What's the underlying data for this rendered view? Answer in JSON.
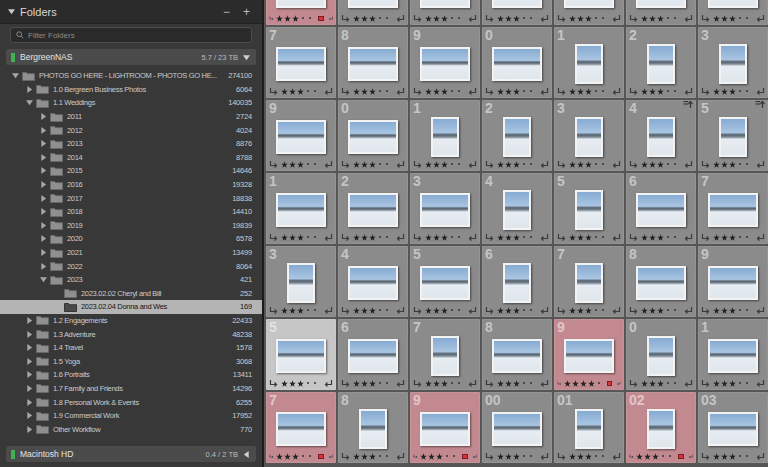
{
  "panel": {
    "title": "Folders",
    "expanded": true,
    "buttons": [
      "−",
      "+"
    ]
  },
  "filter": {
    "placeholder": "Filter Folders"
  },
  "volumes": [
    {
      "name": "BergreenNAS",
      "usage": "5.7 / 23 TB",
      "expanded": true
    },
    {
      "name": "Macintosh HD",
      "usage": "0.4 / 2 TB",
      "expanded": false
    }
  ],
  "folders": [
    {
      "name": "PHOTOS GO HERE - LIGHTROOM - PHOTOS GO HE...",
      "count": "274100",
      "depth": 0,
      "has_children": true,
      "expanded": true,
      "selected": false
    },
    {
      "name": "1.0 Bergreen Business Photos",
      "count": "6064",
      "depth": 1,
      "has_children": true,
      "expanded": false,
      "selected": false
    },
    {
      "name": "1.1 Weddings",
      "count": "140035",
      "depth": 1,
      "has_children": true,
      "expanded": true,
      "selected": false
    },
    {
      "name": "2011",
      "count": "2724",
      "depth": 2,
      "has_children": true,
      "expanded": false,
      "selected": false
    },
    {
      "name": "2012",
      "count": "4024",
      "depth": 2,
      "has_children": true,
      "expanded": false,
      "selected": false
    },
    {
      "name": "2013",
      "count": "8876",
      "depth": 2,
      "has_children": true,
      "expanded": false,
      "selected": false
    },
    {
      "name": "2014",
      "count": "8788",
      "depth": 2,
      "has_children": true,
      "expanded": false,
      "selected": false
    },
    {
      "name": "2015",
      "count": "14646",
      "depth": 2,
      "has_children": true,
      "expanded": false,
      "selected": false
    },
    {
      "name": "2016",
      "count": "19328",
      "depth": 2,
      "has_children": true,
      "expanded": false,
      "selected": false
    },
    {
      "name": "2017",
      "count": "18838",
      "depth": 2,
      "has_children": true,
      "expanded": false,
      "selected": false
    },
    {
      "name": "2018",
      "count": "14410",
      "depth": 2,
      "has_children": true,
      "expanded": false,
      "selected": false
    },
    {
      "name": "2019",
      "count": "19839",
      "depth": 2,
      "has_children": true,
      "expanded": false,
      "selected": false
    },
    {
      "name": "2020",
      "count": "6578",
      "depth": 2,
      "has_children": true,
      "expanded": false,
      "selected": false
    },
    {
      "name": "2021",
      "count": "13499",
      "depth": 2,
      "has_children": true,
      "expanded": false,
      "selected": false
    },
    {
      "name": "2022",
      "count": "8064",
      "depth": 2,
      "has_children": true,
      "expanded": false,
      "selected": false
    },
    {
      "name": "2023",
      "count": "421",
      "depth": 2,
      "has_children": true,
      "expanded": true,
      "selected": false
    },
    {
      "name": "2023.02.02 Cheryl and Bill",
      "count": "252",
      "depth": 3,
      "has_children": false,
      "expanded": false,
      "selected": false
    },
    {
      "name": "2023.02.04 Donna and Wes",
      "count": "169",
      "depth": 3,
      "has_children": false,
      "expanded": false,
      "selected": true
    },
    {
      "name": "1.2 Engagements",
      "count": "22433",
      "depth": 1,
      "has_children": true,
      "expanded": false,
      "selected": false
    },
    {
      "name": "1.3 Adventure",
      "count": "48238",
      "depth": 1,
      "has_children": true,
      "expanded": false,
      "selected": false
    },
    {
      "name": "1.4 Travel",
      "count": "1578",
      "depth": 1,
      "has_children": true,
      "expanded": false,
      "selected": false
    },
    {
      "name": "1.5 Yoga",
      "count": "3068",
      "depth": 1,
      "has_children": true,
      "expanded": false,
      "selected": false
    },
    {
      "name": "1.6 Portraits",
      "count": "13411",
      "depth": 1,
      "has_children": true,
      "expanded": false,
      "selected": false
    },
    {
      "name": "1.7 Family and Friends",
      "count": "14296",
      "depth": 1,
      "has_children": true,
      "expanded": false,
      "selected": false
    },
    {
      "name": "1.8 Personal Work & Events",
      "count": "6255",
      "depth": 1,
      "has_children": true,
      "expanded": false,
      "selected": false
    },
    {
      "name": "1.9 Commercial Work",
      "count": "17952",
      "depth": 1,
      "has_children": true,
      "expanded": false,
      "selected": false
    },
    {
      "name": "Other Workflow",
      "count": "770",
      "depth": 1,
      "has_children": true,
      "expanded": false,
      "selected": false
    }
  ],
  "grid": {
    "rows": [
      {
        "cells": [
          {
            "index": null,
            "orientation": "landscape",
            "stars": 3,
            "tinted": true,
            "label_mark": true,
            "selected": false,
            "badge": false
          },
          {
            "index": null,
            "orientation": "landscape",
            "stars": 3,
            "tinted": false,
            "label_mark": false,
            "selected": false,
            "badge": false
          },
          {
            "index": null,
            "orientation": "landscape",
            "stars": 3,
            "tinted": false,
            "label_mark": false,
            "selected": false,
            "badge": false
          },
          {
            "index": null,
            "orientation": "landscape",
            "stars": 3,
            "tinted": false,
            "label_mark": false,
            "selected": false,
            "badge": false
          },
          {
            "index": null,
            "orientation": "landscape",
            "stars": 3,
            "tinted": false,
            "label_mark": false,
            "selected": false,
            "badge": false
          },
          {
            "index": null,
            "orientation": "landscape",
            "stars": 3,
            "tinted": false,
            "label_mark": false,
            "selected": false,
            "badge": false
          },
          {
            "index": null,
            "orientation": "landscape",
            "stars": 3,
            "tinted": false,
            "label_mark": false,
            "selected": false,
            "badge": false
          }
        ]
      },
      {
        "cells": [
          {
            "index": "7",
            "orientation": "landscape",
            "stars": 3,
            "tinted": false,
            "label_mark": false,
            "selected": false,
            "badge": false
          },
          {
            "index": "8",
            "orientation": "landscape",
            "stars": 3,
            "tinted": false,
            "label_mark": false,
            "selected": false,
            "badge": false
          },
          {
            "index": "9",
            "orientation": "landscape",
            "stars": 3,
            "tinted": false,
            "label_mark": false,
            "selected": false,
            "badge": false
          },
          {
            "index": "0",
            "orientation": "landscape",
            "stars": 3,
            "tinted": false,
            "label_mark": false,
            "selected": false,
            "badge": false
          },
          {
            "index": "1",
            "orientation": "portrait",
            "stars": 3,
            "tinted": false,
            "label_mark": false,
            "selected": false,
            "badge": false
          },
          {
            "index": "2",
            "orientation": "portrait",
            "stars": 3,
            "tinted": false,
            "label_mark": false,
            "selected": false,
            "badge": false
          },
          {
            "index": "3",
            "orientation": "portrait",
            "stars": 3,
            "tinted": false,
            "label_mark": false,
            "selected": false,
            "badge": false
          }
        ]
      },
      {
        "cells": [
          {
            "index": "9",
            "orientation": "landscape",
            "stars": 3,
            "tinted": false,
            "label_mark": false,
            "selected": false,
            "badge": false
          },
          {
            "index": "0",
            "orientation": "landscape",
            "stars": 3,
            "tinted": false,
            "label_mark": false,
            "selected": false,
            "badge": false
          },
          {
            "index": "1",
            "orientation": "portrait",
            "stars": 3,
            "tinted": false,
            "label_mark": false,
            "selected": false,
            "badge": false
          },
          {
            "index": "2",
            "orientation": "portrait",
            "stars": 3,
            "tinted": false,
            "label_mark": false,
            "selected": false,
            "badge": false
          },
          {
            "index": "3",
            "orientation": "portrait",
            "stars": 3,
            "tinted": false,
            "label_mark": false,
            "selected": false,
            "badge": false
          },
          {
            "index": "4",
            "orientation": "portrait",
            "stars": 3,
            "tinted": false,
            "label_mark": false,
            "selected": false,
            "badge": true
          },
          {
            "index": "5",
            "orientation": "portrait",
            "stars": 3,
            "tinted": false,
            "label_mark": false,
            "selected": false,
            "badge": true
          }
        ]
      },
      {
        "cells": [
          {
            "index": "1",
            "orientation": "landscape",
            "stars": 3,
            "tinted": false,
            "label_mark": false,
            "selected": false,
            "badge": false
          },
          {
            "index": "2",
            "orientation": "landscape",
            "stars": 3,
            "tinted": false,
            "label_mark": false,
            "selected": false,
            "badge": false
          },
          {
            "index": "3",
            "orientation": "landscape",
            "stars": 3,
            "tinted": false,
            "label_mark": false,
            "selected": false,
            "badge": false
          },
          {
            "index": "4",
            "orientation": "portrait",
            "stars": 3,
            "tinted": false,
            "label_mark": false,
            "selected": false,
            "badge": false
          },
          {
            "index": "5",
            "orientation": "portrait",
            "stars": 3,
            "tinted": false,
            "label_mark": false,
            "selected": false,
            "badge": false
          },
          {
            "index": "6",
            "orientation": "landscape",
            "stars": 3,
            "tinted": false,
            "label_mark": false,
            "selected": false,
            "badge": false
          },
          {
            "index": "7",
            "orientation": "landscape",
            "stars": 3,
            "tinted": false,
            "label_mark": false,
            "selected": false,
            "badge": false
          }
        ]
      },
      {
        "cells": [
          {
            "index": "3",
            "orientation": "portrait",
            "stars": 3,
            "tinted": false,
            "label_mark": false,
            "selected": false,
            "badge": false
          },
          {
            "index": "4",
            "orientation": "landscape",
            "stars": 3,
            "tinted": false,
            "label_mark": false,
            "selected": false,
            "badge": false
          },
          {
            "index": "5",
            "orientation": "landscape",
            "stars": 3,
            "tinted": false,
            "label_mark": false,
            "selected": false,
            "badge": false
          },
          {
            "index": "6",
            "orientation": "portrait",
            "stars": 3,
            "tinted": false,
            "label_mark": false,
            "selected": false,
            "badge": false
          },
          {
            "index": "7",
            "orientation": "portrait",
            "stars": 3,
            "tinted": false,
            "label_mark": false,
            "selected": false,
            "badge": false
          },
          {
            "index": "8",
            "orientation": "landscape",
            "stars": 3,
            "tinted": false,
            "label_mark": false,
            "selected": false,
            "badge": false
          },
          {
            "index": "9",
            "orientation": "landscape",
            "stars": 3,
            "tinted": false,
            "label_mark": false,
            "selected": false,
            "badge": false
          }
        ]
      },
      {
        "cells": [
          {
            "index": "5",
            "orientation": "landscape",
            "stars": 3,
            "tinted": false,
            "label_mark": false,
            "selected": true,
            "badge": false
          },
          {
            "index": "6",
            "orientation": "landscape",
            "stars": 3,
            "tinted": false,
            "label_mark": false,
            "selected": false,
            "badge": false
          },
          {
            "index": "7",
            "orientation": "portrait",
            "stars": 3,
            "tinted": false,
            "label_mark": false,
            "selected": false,
            "badge": false
          },
          {
            "index": "8",
            "orientation": "landscape",
            "stars": 3,
            "tinted": false,
            "label_mark": false,
            "selected": false,
            "badge": false
          },
          {
            "index": "9",
            "orientation": "landscape",
            "stars": 4,
            "tinted": true,
            "label_mark": true,
            "selected": false,
            "badge": false
          },
          {
            "index": "0",
            "orientation": "portrait",
            "stars": 3,
            "tinted": false,
            "label_mark": false,
            "selected": false,
            "badge": false
          },
          {
            "index": "1",
            "orientation": "landscape",
            "stars": 3,
            "tinted": false,
            "label_mark": false,
            "selected": false,
            "badge": false
          }
        ]
      },
      {
        "cells": [
          {
            "index": "7",
            "orientation": "landscape",
            "stars": 3,
            "tinted": true,
            "label_mark": true,
            "selected": false,
            "badge": false
          },
          {
            "index": "8",
            "orientation": "portrait",
            "stars": 3,
            "tinted": false,
            "label_mark": false,
            "selected": false,
            "badge": false
          },
          {
            "index": "9",
            "orientation": "landscape",
            "stars": 3,
            "tinted": true,
            "label_mark": true,
            "selected": false,
            "badge": false
          },
          {
            "index": "00",
            "orientation": "landscape",
            "stars": 3,
            "tinted": false,
            "label_mark": false,
            "selected": false,
            "badge": false
          },
          {
            "index": "01",
            "orientation": "portrait",
            "stars": 3,
            "tinted": false,
            "label_mark": false,
            "selected": false,
            "badge": false
          },
          {
            "index": "02",
            "orientation": "portrait",
            "stars": 3,
            "tinted": true,
            "label_mark": true,
            "selected": false,
            "badge": false
          },
          {
            "index": "03",
            "orientation": "landscape",
            "stars": 3,
            "tinted": false,
            "label_mark": false,
            "selected": false,
            "badge": false
          }
        ]
      }
    ]
  }
}
